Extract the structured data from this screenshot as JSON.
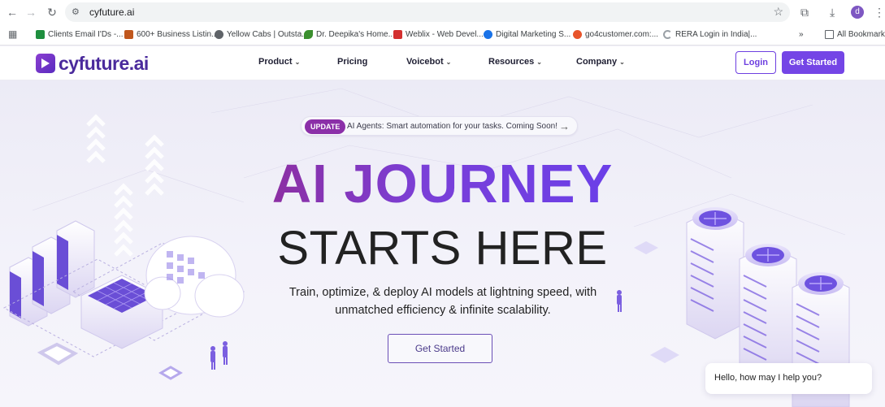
{
  "browser": {
    "url": "cyfuture.ai",
    "profile_initial": "d",
    "bookmarks": [
      {
        "label": "Clients Email I'Ds -...",
        "icon": "sheets-icon",
        "color": "#1e8e3e"
      },
      {
        "label": "600+ Business Listin...",
        "icon": "doc-icon",
        "color": "#c0571d"
      },
      {
        "label": "Yellow Cabs | Outsta...",
        "icon": "globe-icon",
        "color": "#5f6368"
      },
      {
        "label": "Dr. Deepika's Home...",
        "icon": "leaf-icon",
        "color": "#3b8f2e"
      },
      {
        "label": "Weblix - Web Devel...",
        "icon": "w-icon",
        "color": "#d32f2f"
      },
      {
        "label": "Digital Marketing S...",
        "icon": "search-icon",
        "color": "#1a73e8"
      },
      {
        "label": "go4customer.com:...",
        "icon": "go4-icon",
        "color": "#e8542a"
      },
      {
        "label": "RERA Login in India|...",
        "icon": "spinner-icon",
        "color": "#5f6368"
      },
      {
        "label": "All Bookmarks",
        "icon": "folder-icon",
        "color": "#5f6368"
      }
    ],
    "bookmarks_overflow": "»"
  },
  "header": {
    "logo_text": "cyfuture.ai",
    "menu": [
      {
        "label": "Product",
        "dropdown": true
      },
      {
        "label": "Pricing",
        "dropdown": false
      },
      {
        "label": "Voicebot",
        "dropdown": true
      },
      {
        "label": "Resources",
        "dropdown": true
      },
      {
        "label": "Company",
        "dropdown": true
      }
    ],
    "login_label": "Login",
    "get_started_label": "Get Started"
  },
  "hero": {
    "update_badge": "UPDATE",
    "update_text": "AI Agents: Smart automation for your tasks. Coming Soon!",
    "headline_line1": "AI JOURNEY",
    "headline_line2": "STARTS HERE",
    "subtext": "Train, optimize, & deploy AI models at lightning speed, with unmatched efficiency & infinite scalability.",
    "cta_label": "Get Started"
  },
  "chat": {
    "greeting": "Hello, how may I help you?"
  },
  "colors": {
    "brand": "#6b3fe0",
    "accent_magenta": "#8b2fa8",
    "hero_bg": "#efeef8"
  }
}
